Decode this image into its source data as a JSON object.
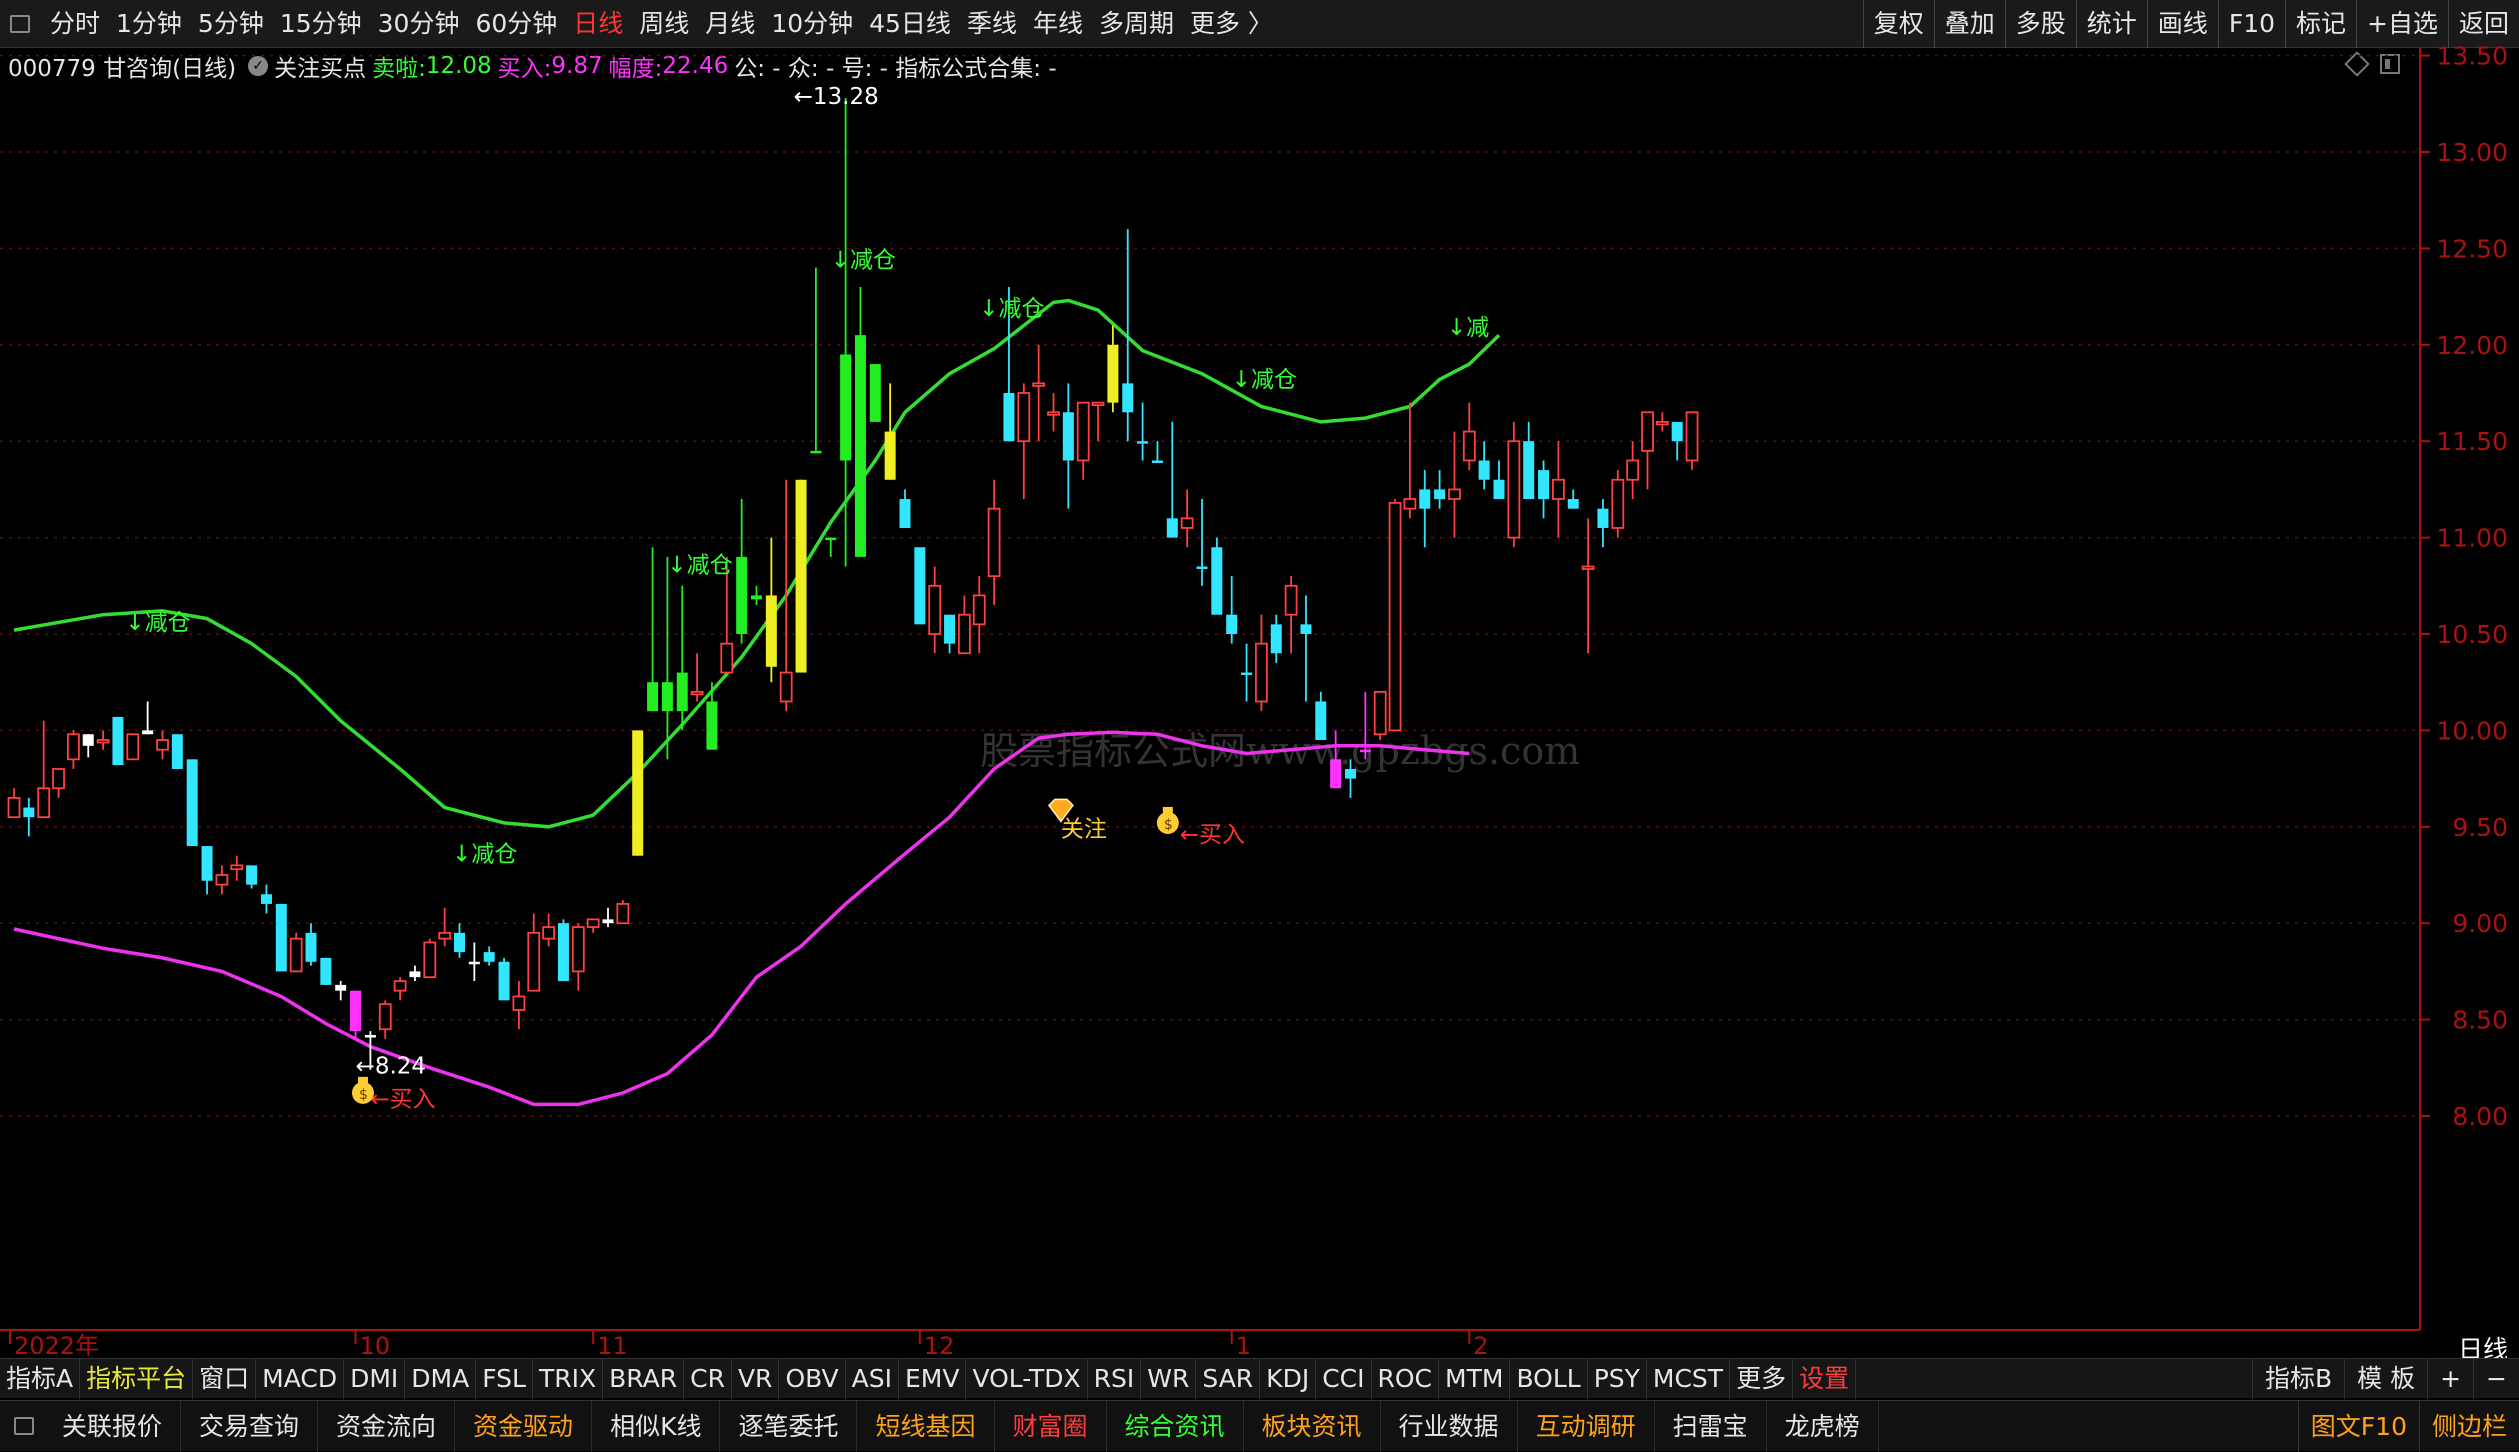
{
  "topbar": {
    "periods": [
      "分时",
      "1分钟",
      "5分钟",
      "15分钟",
      "30分钟",
      "60分钟",
      "日线",
      "周线",
      "月线",
      "10分钟",
      "45日线",
      "季线",
      "年线",
      "多周期",
      "更多 〉"
    ],
    "active_period": "日线",
    "right_buttons": [
      "复权",
      "叠加",
      "多股",
      "统计",
      "画线",
      "F10",
      "标记",
      "+自选",
      "返回"
    ]
  },
  "info": {
    "code_name": "000779 甘咨询(日线)",
    "signal_name": "关注买点",
    "sell_label": "卖啦:",
    "sell_value": "12.08",
    "buy_label": "买入:",
    "buy_value": "9.87",
    "range_label": "幅度:",
    "range_value": "22.46",
    "extra": "公: -  众: -  号: -  指标公式合集: -"
  },
  "watermark": "股票指标公式网www.gpzbgs.com",
  "chart_data": {
    "type": "candlestick",
    "y_ticks": [
      "13.50",
      "13.00",
      "12.50",
      "12.00",
      "11.50",
      "11.00",
      "10.50",
      "10.00",
      "9.50",
      "9.00",
      "8.50",
      "8.00"
    ],
    "ylim": [
      7.75,
      14.0
    ],
    "x_labels": [
      {
        "label": "2022年",
        "i": 0
      },
      {
        "label": "10",
        "i": 23
      },
      {
        "label": "11",
        "i": 39
      },
      {
        "label": "12",
        "i": 61
      },
      {
        "label": "1",
        "i": 82
      },
      {
        "label": "2",
        "i": 98
      }
    ],
    "candles": [
      [
        9.65,
        9.7,
        9.55,
        9.55,
        "r"
      ],
      [
        9.6,
        9.65,
        9.45,
        9.55,
        "c"
      ],
      [
        9.55,
        10.05,
        9.55,
        9.7,
        "r"
      ],
      [
        9.7,
        9.8,
        9.65,
        9.8,
        "r"
      ],
      [
        9.85,
        10.0,
        9.8,
        9.98,
        "r"
      ],
      [
        9.98,
        9.98,
        9.86,
        9.92,
        "w"
      ],
      [
        9.95,
        10.0,
        9.9,
        9.95,
        "r"
      ],
      [
        10.07,
        10.05,
        9.9,
        9.82,
        "c"
      ],
      [
        9.85,
        9.98,
        9.85,
        9.98,
        "r"
      ],
      [
        9.98,
        10.15,
        9.98,
        10.0,
        "w"
      ],
      [
        9.95,
        10.0,
        9.85,
        9.9,
        "r"
      ],
      [
        9.98,
        9.98,
        9.8,
        9.8,
        "c"
      ],
      [
        9.85,
        9.85,
        9.4,
        9.4,
        "c"
      ],
      [
        9.4,
        9.4,
        9.15,
        9.22,
        "c"
      ],
      [
        9.2,
        9.3,
        9.15,
        9.25,
        "r"
      ],
      [
        9.28,
        9.35,
        9.22,
        9.3,
        "r"
      ],
      [
        9.3,
        9.3,
        9.18,
        9.2,
        "c"
      ],
      [
        9.15,
        9.2,
        9.05,
        9.1,
        "c"
      ],
      [
        9.1,
        9.1,
        8.75,
        8.75,
        "c"
      ],
      [
        8.75,
        8.95,
        8.75,
        8.92,
        "r"
      ],
      [
        8.95,
        9.0,
        8.78,
        8.8,
        "c"
      ],
      [
        8.82,
        8.82,
        8.68,
        8.68,
        "c"
      ],
      [
        8.68,
        8.7,
        8.6,
        8.65,
        "w"
      ],
      [
        8.65,
        8.65,
        8.4,
        8.44,
        "m"
      ],
      [
        8.42,
        8.44,
        8.24,
        8.42,
        "w"
      ],
      [
        8.45,
        8.6,
        8.4,
        8.58,
        "r"
      ],
      [
        8.65,
        8.72,
        8.6,
        8.7,
        "r"
      ],
      [
        8.72,
        8.78,
        8.7,
        8.75,
        "w"
      ],
      [
        8.72,
        8.92,
        8.72,
        8.9,
        "r"
      ],
      [
        8.92,
        9.08,
        8.88,
        8.95,
        "r"
      ],
      [
        8.95,
        9.0,
        8.82,
        8.85,
        "c"
      ],
      [
        8.8,
        8.9,
        8.7,
        8.8,
        "w"
      ],
      [
        8.85,
        8.88,
        8.78,
        8.8,
        "c"
      ],
      [
        8.8,
        8.82,
        8.6,
        8.6,
        "c"
      ],
      [
        8.62,
        8.7,
        8.45,
        8.55,
        "r"
      ],
      [
        8.65,
        9.05,
        8.65,
        8.95,
        "r"
      ],
      [
        8.98,
        9.05,
        8.88,
        8.92,
        "r"
      ],
      [
        9.0,
        9.02,
        8.72,
        8.7,
        "c"
      ],
      [
        8.75,
        9.0,
        8.65,
        8.98,
        "r"
      ],
      [
        8.98,
        9.02,
        8.95,
        9.02,
        "r"
      ],
      [
        9.02,
        9.08,
        8.98,
        9.0,
        "w"
      ],
      [
        9.0,
        9.12,
        9.0,
        9.1,
        "r"
      ],
      [
        9.35,
        10.0,
        9.35,
        10.0,
        "y"
      ],
      [
        10.25,
        10.95,
        10.1,
        10.1,
        "g"
      ],
      [
        10.1,
        10.9,
        9.85,
        10.25,
        "g"
      ],
      [
        10.1,
        10.75,
        10.0,
        10.3,
        "g"
      ],
      [
        10.2,
        10.4,
        10.15,
        10.2,
        "r"
      ],
      [
        10.15,
        10.25,
        9.9,
        9.9,
        "g"
      ],
      [
        10.3,
        10.9,
        10.3,
        10.45,
        "r"
      ],
      [
        10.5,
        11.2,
        10.45,
        10.9,
        "g"
      ],
      [
        10.68,
        10.75,
        10.65,
        10.7,
        "g"
      ],
      [
        10.33,
        11.0,
        10.25,
        10.7,
        "y"
      ],
      [
        10.15,
        11.3,
        10.1,
        10.3,
        "r"
      ],
      [
        10.3,
        11.3,
        10.3,
        11.3,
        "y"
      ],
      [
        11.45,
        12.4,
        11.45,
        11.45,
        "g"
      ],
      [
        11.0,
        11.0,
        10.9,
        11.0,
        "g"
      ],
      [
        11.95,
        13.28,
        10.85,
        11.4,
        "g"
      ],
      [
        12.05,
        12.3,
        10.9,
        10.9,
        "g"
      ],
      [
        11.9,
        11.9,
        11.6,
        11.6,
        "g"
      ],
      [
        11.3,
        11.8,
        11.3,
        11.55,
        "y"
      ],
      [
        11.2,
        11.25,
        11.05,
        11.05,
        "c"
      ],
      [
        10.95,
        10.95,
        10.95,
        10.55,
        "c"
      ],
      [
        10.5,
        10.85,
        10.4,
        10.75,
        "r"
      ],
      [
        10.6,
        10.6,
        10.4,
        10.45,
        "c"
      ],
      [
        10.4,
        10.7,
        10.4,
        10.6,
        "r"
      ],
      [
        10.55,
        10.8,
        10.4,
        10.7,
        "r"
      ],
      [
        10.8,
        11.3,
        10.65,
        11.15,
        "r"
      ],
      [
        11.75,
        12.3,
        11.5,
        11.5,
        "c"
      ],
      [
        11.5,
        11.8,
        11.2,
        11.75,
        "r"
      ],
      [
        11.8,
        12.0,
        11.5,
        11.8,
        "r"
      ],
      [
        11.65,
        11.75,
        11.55,
        11.65,
        "r"
      ],
      [
        11.65,
        11.8,
        11.15,
        11.4,
        "c"
      ],
      [
        11.4,
        11.7,
        11.3,
        11.7,
        "r"
      ],
      [
        11.7,
        11.7,
        11.5,
        11.7,
        "r"
      ],
      [
        12.0,
        12.1,
        11.65,
        11.7,
        "y"
      ],
      [
        11.8,
        12.6,
        11.5,
        11.65,
        "c"
      ],
      [
        11.5,
        11.7,
        11.4,
        11.5,
        "c"
      ],
      [
        11.4,
        11.5,
        11.4,
        11.4,
        "c"
      ],
      [
        11.1,
        11.6,
        11.0,
        11.0,
        "c"
      ],
      [
        11.1,
        11.25,
        10.95,
        11.05,
        "r"
      ],
      [
        10.85,
        11.2,
        10.75,
        10.85,
        "c"
      ],
      [
        10.95,
        11.0,
        10.85,
        10.6,
        "c"
      ],
      [
        10.6,
        10.8,
        10.45,
        10.5,
        "c"
      ],
      [
        10.3,
        10.45,
        10.15,
        10.3,
        "c"
      ],
      [
        10.15,
        10.6,
        10.1,
        10.45,
        "r"
      ],
      [
        10.55,
        10.6,
        10.35,
        10.4,
        "c"
      ],
      [
        10.6,
        10.8,
        10.4,
        10.75,
        "r"
      ],
      [
        10.5,
        10.7,
        10.15,
        10.55,
        "c"
      ],
      [
        10.15,
        10.2,
        9.95,
        9.95,
        "c"
      ],
      [
        9.85,
        10.0,
        9.7,
        9.7,
        "m"
      ],
      [
        9.75,
        9.85,
        9.65,
        9.8,
        "c"
      ],
      [
        9.9,
        10.2,
        9.85,
        9.9,
        "m"
      ],
      [
        10.2,
        10.2,
        9.95,
        9.98,
        "r"
      ],
      [
        10.0,
        11.2,
        10.0,
        11.18,
        "r"
      ],
      [
        11.2,
        11.7,
        11.1,
        11.15,
        "r"
      ],
      [
        11.15,
        11.35,
        10.95,
        11.25,
        "c"
      ],
      [
        11.25,
        11.35,
        11.15,
        11.2,
        "c"
      ],
      [
        11.2,
        11.55,
        11.0,
        11.25,
        "r"
      ],
      [
        11.55,
        11.7,
        11.35,
        11.4,
        "r"
      ],
      [
        11.4,
        11.5,
        11.25,
        11.3,
        "c"
      ],
      [
        11.3,
        11.4,
        11.2,
        11.2,
        "c"
      ],
      [
        11.0,
        11.6,
        10.95,
        11.5,
        "r"
      ],
      [
        11.5,
        11.6,
        11.3,
        11.2,
        "c"
      ],
      [
        11.35,
        11.4,
        11.1,
        11.2,
        "c"
      ],
      [
        11.2,
        11.5,
        11.0,
        11.3,
        "r"
      ],
      [
        11.2,
        11.25,
        11.15,
        11.15,
        "c"
      ],
      [
        10.85,
        11.1,
        10.4,
        10.85,
        "r"
      ],
      [
        11.15,
        11.2,
        10.95,
        11.05,
        "c"
      ],
      [
        11.05,
        11.35,
        11.0,
        11.3,
        "r"
      ],
      [
        11.3,
        11.5,
        11.2,
        11.4,
        "r"
      ],
      [
        11.45,
        11.65,
        11.25,
        11.65,
        "r"
      ],
      [
        11.6,
        11.65,
        11.55,
        11.6,
        "r"
      ],
      [
        11.6,
        11.6,
        11.4,
        11.5,
        "c"
      ],
      [
        11.4,
        11.65,
        11.35,
        11.65,
        "r"
      ]
    ],
    "upper_band": [
      [
        0,
        10.52
      ],
      [
        6,
        10.6
      ],
      [
        10,
        10.62
      ],
      [
        13,
        10.58
      ],
      [
        16,
        10.45
      ],
      [
        19,
        10.28
      ],
      [
        22,
        10.05
      ],
      [
        26,
        9.8
      ],
      [
        29,
        9.6
      ],
      [
        33,
        9.52
      ],
      [
        36,
        9.5
      ],
      [
        39,
        9.56
      ],
      [
        42,
        9.78
      ],
      [
        45,
        10.03
      ],
      [
        49,
        10.38
      ],
      [
        52,
        10.7
      ],
      [
        55,
        11.08
      ],
      [
        58,
        11.4
      ],
      [
        60,
        11.65
      ],
      [
        63,
        11.85
      ],
      [
        66,
        11.98
      ],
      [
        68,
        12.1
      ],
      [
        70,
        12.22
      ],
      [
        71,
        12.23
      ],
      [
        73,
        12.18
      ],
      [
        76,
        11.97
      ],
      [
        80,
        11.85
      ],
      [
        84,
        11.68
      ],
      [
        88,
        11.6
      ],
      [
        91,
        11.62
      ],
      [
        94,
        11.68
      ],
      [
        96,
        11.82
      ],
      [
        98,
        11.9
      ],
      [
        100,
        12.05
      ]
    ],
    "lower_band": [
      [
        0,
        8.97
      ],
      [
        6,
        8.87
      ],
      [
        10,
        8.82
      ],
      [
        14,
        8.75
      ],
      [
        18,
        8.62
      ],
      [
        21,
        8.48
      ],
      [
        24,
        8.36
      ],
      [
        28,
        8.25
      ],
      [
        32,
        8.15
      ],
      [
        35,
        8.06
      ],
      [
        38,
        8.06
      ],
      [
        41,
        8.12
      ],
      [
        44,
        8.22
      ],
      [
        47,
        8.42
      ],
      [
        50,
        8.72
      ],
      [
        53,
        8.88
      ],
      [
        56,
        9.1
      ],
      [
        60,
        9.36
      ],
      [
        63,
        9.55
      ],
      [
        66,
        9.8
      ],
      [
        69,
        9.96
      ],
      [
        71,
        9.98
      ],
      [
        74,
        9.99
      ],
      [
        77,
        9.98
      ],
      [
        80,
        9.92
      ],
      [
        83,
        9.88
      ],
      [
        86,
        9.9
      ],
      [
        89,
        9.92
      ],
      [
        92,
        9.92
      ],
      [
        95,
        9.9
      ],
      [
        98,
        9.88
      ]
    ],
    "annotations": [
      {
        "text": "↓减仓",
        "i": 7.5,
        "y": 10.52,
        "color": "#33ff33"
      },
      {
        "text": "↓减仓",
        "i": 29.5,
        "y": 9.32,
        "color": "#33ff33"
      },
      {
        "text": "↓减仓",
        "i": 44,
        "y": 10.82,
        "color": "#33ff33"
      },
      {
        "text": "↓减仓",
        "i": 55,
        "y": 12.4,
        "color": "#33ff33"
      },
      {
        "text": "↓减仓",
        "i": 65,
        "y": 12.15,
        "color": "#33ff33"
      },
      {
        "text": "↓减仓",
        "i": 82,
        "y": 11.78,
        "color": "#33ff33"
      },
      {
        "text": "↓减",
        "i": 96.5,
        "y": 12.05,
        "color": "#33ff33"
      },
      {
        "text": "←13.28",
        "i": 52.5,
        "y": 13.25,
        "color": "#ffffff"
      },
      {
        "text": "←8.24",
        "i": 23,
        "y": 8.22,
        "color": "#ffffff"
      },
      {
        "text": "←买入",
        "i": 24,
        "y": 8.05,
        "color": "#ff3333"
      },
      {
        "text": "←买入",
        "i": 78.5,
        "y": 9.42,
        "color": "#ff3333"
      },
      {
        "text": "关注",
        "i": 70.5,
        "y": 9.45,
        "color": "#ffcc33"
      }
    ],
    "icons": [
      {
        "name": "money-bag-icon",
        "i": 23.5,
        "y": 8.12,
        "color": "#ffcc33"
      },
      {
        "name": "money-bag-icon",
        "i": 77.7,
        "y": 9.52,
        "color": "#ffcc33"
      },
      {
        "name": "diamond-gem-icon",
        "i": 70.5,
        "y": 9.58,
        "color": "#ffaa22"
      }
    ],
    "grid": true,
    "colors": {
      "up": "#ff4040",
      "down": "#33e6ff",
      "sell_zone": "#22ee22",
      "buy_zone": "#ff33ff",
      "transition": "#eeee22",
      "flat": "#ffffff",
      "upper_band": "#33dd33",
      "lower_band": "#ee33ee",
      "axis": "#aa1111"
    }
  },
  "bottom_axis_label": "日线",
  "indicators": [
    "指标A",
    "指标平台",
    "窗口",
    "MACD",
    "DMI",
    "DMA",
    "FSL",
    "TRIX",
    "BRAR",
    "CR",
    "VR",
    "OBV",
    "ASI",
    "EMV",
    "VOL-TDX",
    "RSI",
    "WR",
    "SAR",
    "KDJ",
    "CCI",
    "ROC",
    "MTM",
    "BOLL",
    "PSY",
    "MCST",
    "更多",
    "设置"
  ],
  "indicators_right": [
    "指标B",
    "模 板",
    "+",
    "−"
  ],
  "functions": [
    "关联报价",
    "交易查询",
    "资金流向",
    "资金驱动",
    "相似K线",
    "逐笔委托",
    "短线基因",
    "财富圈",
    "综合资讯",
    "板块资讯",
    "行业数据",
    "互动调研",
    "扫雷宝",
    "龙虎榜"
  ],
  "functions_right": [
    "图文F10",
    "侧边栏"
  ]
}
